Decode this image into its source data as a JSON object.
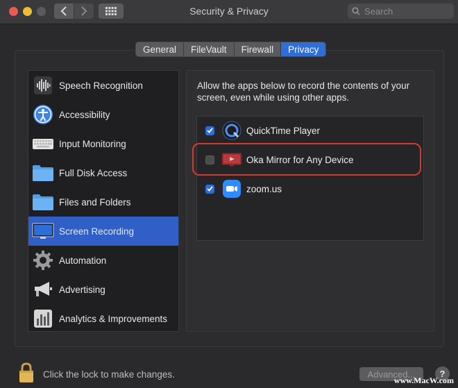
{
  "window": {
    "title": "Security & Privacy"
  },
  "search": {
    "placeholder": "Search"
  },
  "tabs": [
    {
      "label": "General",
      "active": false
    },
    {
      "label": "FileVault",
      "active": false
    },
    {
      "label": "Firewall",
      "active": false
    },
    {
      "label": "Privacy",
      "active": true
    }
  ],
  "sidebar": {
    "items": [
      {
        "label": "Speech Recognition",
        "icon": "speech-recognition-icon"
      },
      {
        "label": "Accessibility",
        "icon": "accessibility-icon"
      },
      {
        "label": "Input Monitoring",
        "icon": "keyboard-icon"
      },
      {
        "label": "Full Disk Access",
        "icon": "folder-icon"
      },
      {
        "label": "Files and Folders",
        "icon": "folder-icon"
      },
      {
        "label": "Screen Recording",
        "icon": "display-icon",
        "selected": true
      },
      {
        "label": "Automation",
        "icon": "gear-icon"
      },
      {
        "label": "Advertising",
        "icon": "megaphone-icon"
      },
      {
        "label": "Analytics & Improvements",
        "icon": "analytics-icon"
      }
    ]
  },
  "main": {
    "description": "Allow the apps below to record the contents of your screen, even while using other apps.",
    "apps": [
      {
        "label": "QuickTime Player",
        "checked": true,
        "icon": "quicktime-icon"
      },
      {
        "label": "Oka Mirror for Any Device",
        "checked": false,
        "icon": "oka-mirror-icon"
      },
      {
        "label": "zoom.us",
        "checked": true,
        "icon": "zoom-icon"
      }
    ]
  },
  "footer": {
    "lock_text": "Click the lock to make changes.",
    "advanced_label": "Advanced...",
    "help_label": "?"
  },
  "watermark": "www.MacW.com",
  "colors": {
    "accent": "#2f6ed6",
    "highlight": "#d23b2d"
  }
}
